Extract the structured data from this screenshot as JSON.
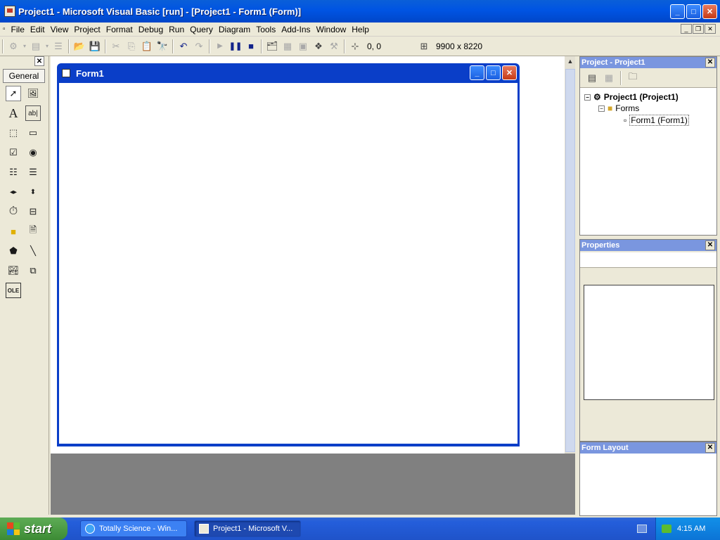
{
  "window": {
    "title": "Project1 - Microsoft Visual Basic [run] - [Project1 - Form1 (Form)]"
  },
  "menu": [
    "File",
    "Edit",
    "View",
    "Project",
    "Format",
    "Debug",
    "Run",
    "Query",
    "Diagram",
    "Tools",
    "Add-Ins",
    "Window",
    "Help"
  ],
  "toolbar": {
    "position": "0, 0",
    "size": "9900 x 8220"
  },
  "toolbox": {
    "tab": "General",
    "close_glyph": "✕"
  },
  "form": {
    "title": "Form1"
  },
  "project_panel": {
    "title": "Project - Project1",
    "root": "Project1 (Project1)",
    "folder": "Forms",
    "item": "Form1 (Form1)"
  },
  "properties_panel": {
    "title": "Properties"
  },
  "layout_panel": {
    "title": "Form Layout"
  },
  "taskbar": {
    "start": "start",
    "tasks": [
      "Totally Science - Win...",
      "Project1 - Microsoft V..."
    ],
    "time": "4:15 AM"
  },
  "colors": {
    "title_blue": "#0054e3",
    "panel_head": "#7a96df",
    "workspace_gray": "#808080"
  }
}
